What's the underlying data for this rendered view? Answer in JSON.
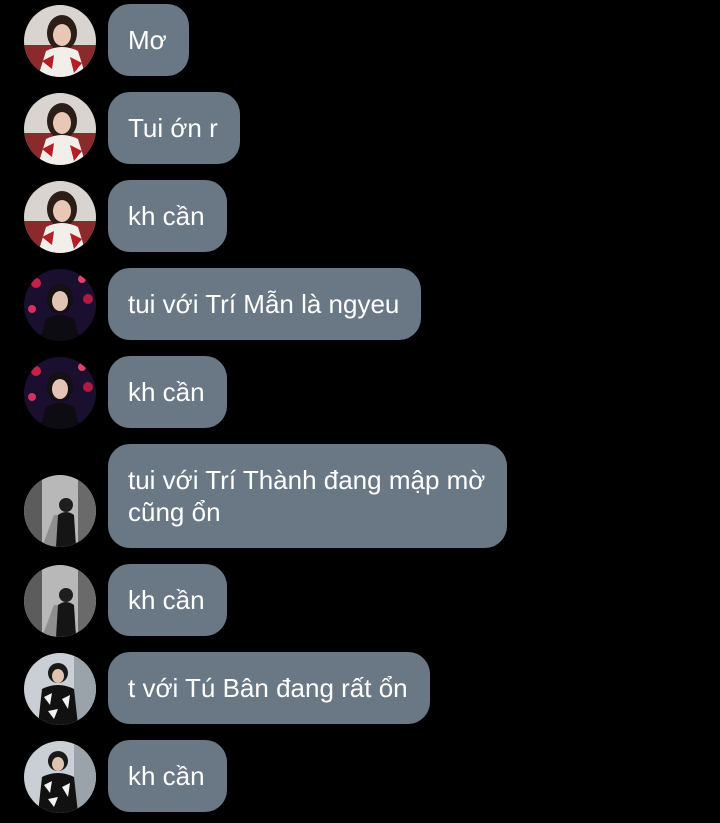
{
  "messages": [
    {
      "sender": "user-a",
      "text": "Mơ"
    },
    {
      "sender": "user-a",
      "text": "Tui ớn r"
    },
    {
      "sender": "user-a",
      "text": "kh cần"
    },
    {
      "sender": "user-b",
      "text": "tui với Trí Mẫn là ngyeu"
    },
    {
      "sender": "user-b",
      "text": "kh cần"
    },
    {
      "sender": "user-c",
      "text": "tui với Trí Thành đang mập mờ\ncũng ổn"
    },
    {
      "sender": "user-c",
      "text": "kh cần"
    },
    {
      "sender": "user-d",
      "text": "t với Tú Bân đang rất ổn"
    },
    {
      "sender": "user-d",
      "text": "kh cần"
    }
  ],
  "colors": {
    "background": "#000000",
    "bubble": "#6a7886",
    "text": "#ffffff"
  }
}
